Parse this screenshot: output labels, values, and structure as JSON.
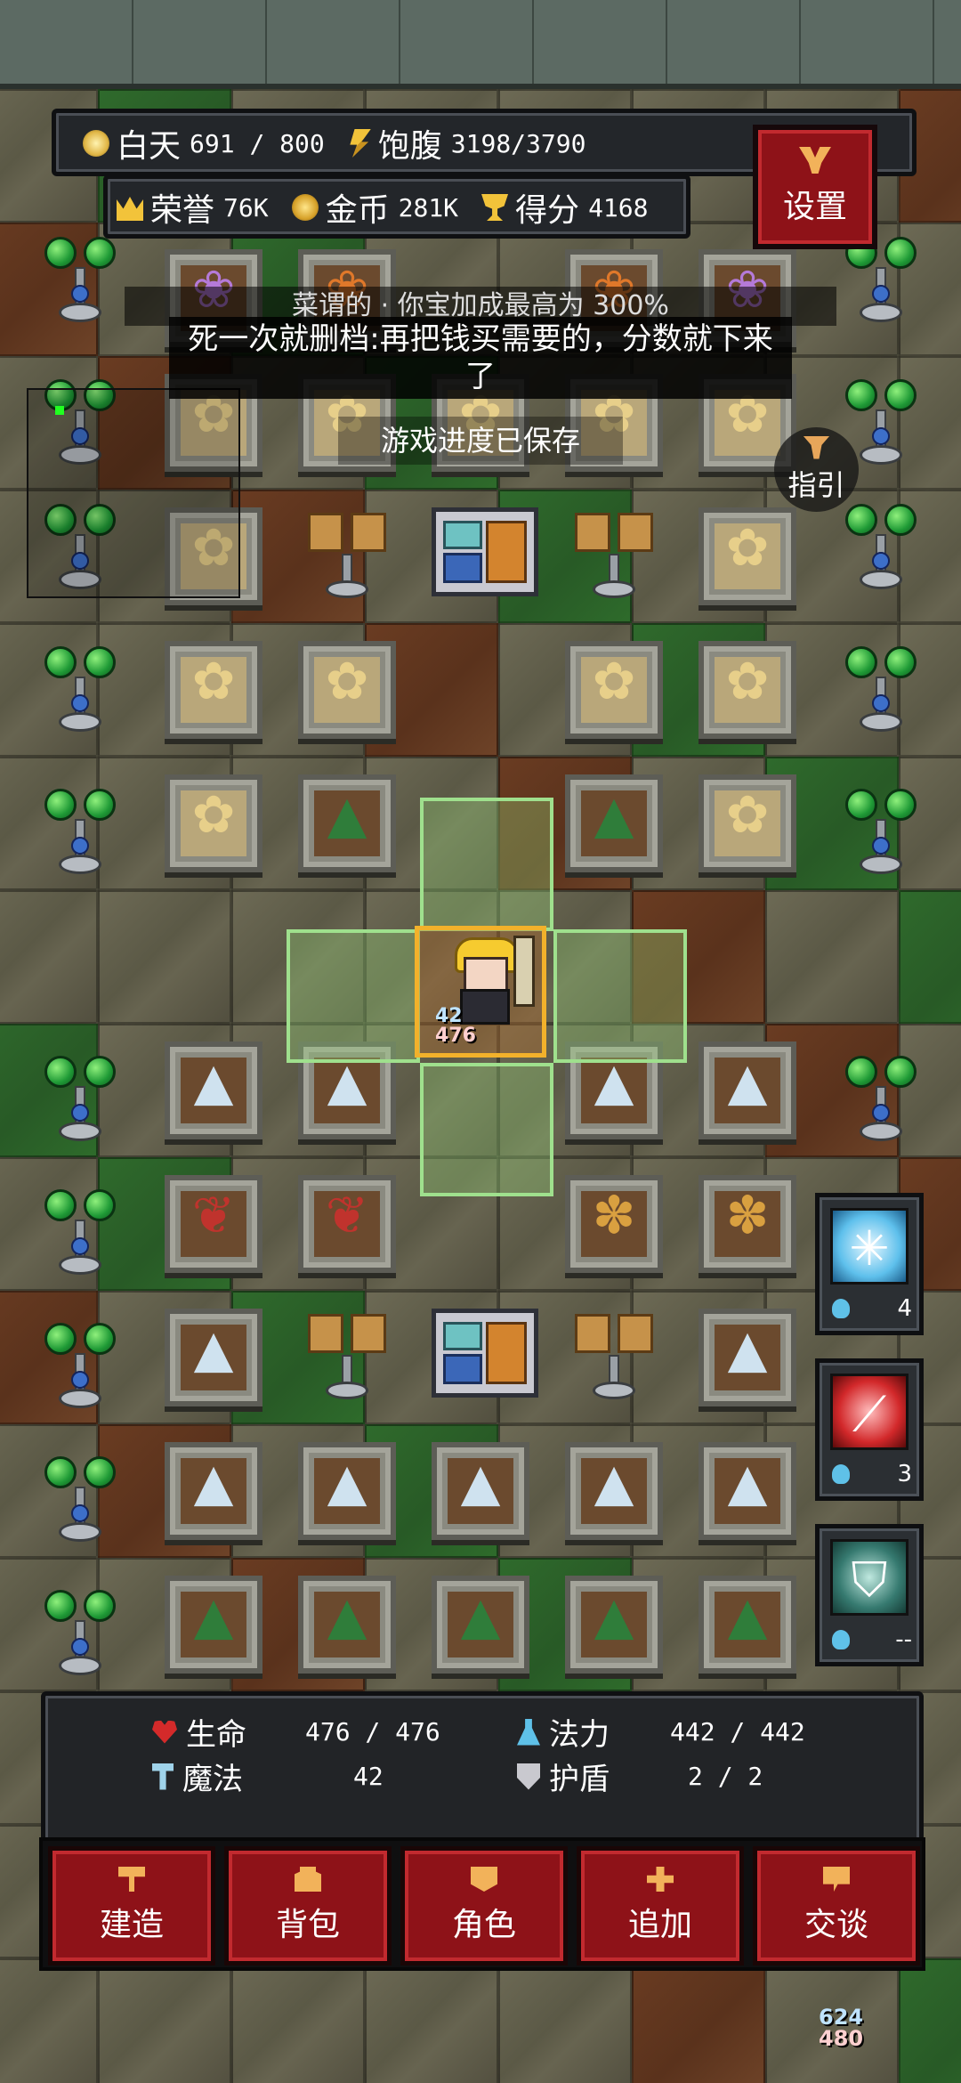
{
  "hud": {
    "day_label": "白天",
    "day_value": "691 / 800",
    "hunger_label": "饱腹",
    "hunger_value": "3198/3790",
    "honor_label": "荣誉",
    "honor_value": "76K",
    "gold_label": "金币",
    "gold_value": "281K",
    "score_label": "得分",
    "score_value": "4168"
  },
  "buttons": {
    "settings": "设置",
    "guide": "指引"
  },
  "messages": {
    "behind_text": "菜谓的 · 你宝加成最高为 300%",
    "toast": "死一次就删档:再把钱买需要的，分数就下来了",
    "saved": "游戏进度已保存"
  },
  "player": {
    "magic": "42",
    "hp": "476"
  },
  "skills": [
    {
      "icon": "frost-rune-icon",
      "count": "4"
    },
    {
      "icon": "red-slash-icon",
      "count": "3"
    },
    {
      "icon": "shield-icon",
      "count": "--"
    }
  ],
  "stats": {
    "hp_label": "生命",
    "hp_value": "476 / 476",
    "mana_label": "法力",
    "mana_value": "442 / 442",
    "magic_label": "魔法",
    "magic_value": "42",
    "shield_label": "护盾",
    "shield_value": "2 / 2"
  },
  "nav": [
    {
      "label": "建造",
      "icon": "build-icon"
    },
    {
      "label": "背包",
      "icon": "bag-icon"
    },
    {
      "label": "角色",
      "icon": "character-icon"
    },
    {
      "label": "追加",
      "icon": "plus-icon"
    },
    {
      "label": "交谈",
      "icon": "chat-icon"
    }
  ],
  "corner": {
    "magic": "624",
    "hp": "480"
  },
  "colors": {
    "button_red": "#8e1218",
    "highlight_green": "#9fe08d",
    "player_frame": "#f2b12b"
  }
}
